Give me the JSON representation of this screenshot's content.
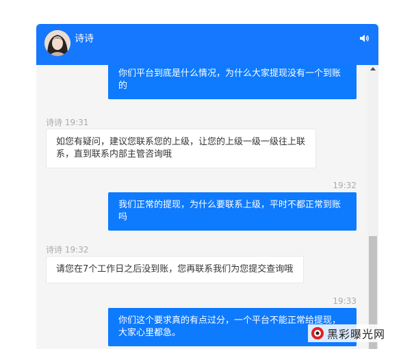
{
  "header": {
    "name": "诗诗"
  },
  "messages": [
    {
      "side": "out",
      "time": "",
      "text": "你们平台到底是什么情况，为什么大家提现没有一个到账的"
    },
    {
      "side": "in",
      "time": "诗诗 19:31",
      "text": "如您有疑问，建议您联系您的上级，让您的上级一级一级往上联系，直到联系内部主管咨询哦"
    },
    {
      "side": "out",
      "time": "19:32",
      "text": "我们正常的提现，为什么要联系上级，平时不都正常到账吗"
    },
    {
      "side": "in",
      "time": "诗诗 19:32",
      "text": "请您在7个工作日之后没到账，您再联系我们为您提交查询哦"
    },
    {
      "side": "out",
      "time": "19:33",
      "text": "你们这个要求真的有点过分，一个平台不能正常给提现，大家心里都急。"
    }
  ],
  "watermark": {
    "text": "黑彩曝光网"
  },
  "colors": {
    "header": "#1677ff",
    "bubble_out": "#0e7afe",
    "bubble_in": "#ffffff",
    "background": "#f5f5f5"
  },
  "icons": [
    "avatar",
    "speaker-icon",
    "scroll-up-arrow-icon",
    "watermark-logo-icon"
  ]
}
